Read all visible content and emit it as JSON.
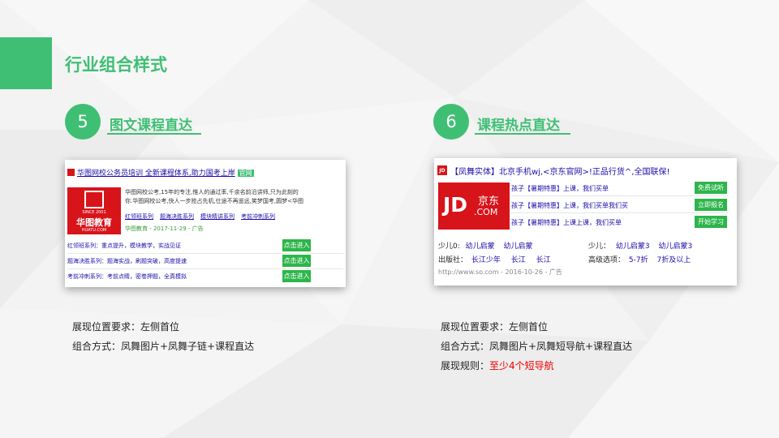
{
  "page_title": "行业组合样式",
  "colors": {
    "accent": "#3fbf74",
    "button_green": "#2db54b",
    "link": "#1a0dab",
    "red": "#e00000",
    "jd_red": "#d7141a"
  },
  "section1": {
    "number": "5",
    "title": "图文课程直达",
    "card": {
      "logo_icon": "hu-logo-icon",
      "title_link": "华图网校公务员培训 全新课程体系,助力国考上岸",
      "badge": "官网",
      "logo_text": "华图教育",
      "logo_sub": "SINCE 2001",
      "logo_url": "HUATU.COM",
      "desc1": "华图网校公考,15年的专注,惟人的通过率,千余名前沿讲师,只为此刻的",
      "desc2": "你.华图网校公考,快人一步抢占先机,仕途不再遥远,笑梦国考,圆梦<华图",
      "sublinks": [
        "红领班系列",
        "题海决胜系列",
        "模块精讲系列",
        "考前冲刺系列"
      ],
      "meta": "华图教育 - 2017-11-29 - 广告",
      "rows": [
        {
          "text": "红领班系列：重点提升，模块教学，实战见证",
          "button": "点击进入"
        },
        {
          "text": "题海决胜系列：题海实战，刷题突破，高度提速",
          "button": "点击进入"
        },
        {
          "text": "考前冲刺系列：考前点睛，密卷押题，全真模拟",
          "button": "点击进入"
        }
      ]
    },
    "desc": [
      {
        "text": "展现位置要求：左侧首位"
      },
      {
        "text": "组合方式：凤舞图片+凤舞子链+课程直达"
      }
    ]
  },
  "section2": {
    "number": "6",
    "title": "课程热点直达",
    "card": {
      "jd_icon_text": "JD",
      "title_link": "【凤舞实体】北京手机wj,<京东官网>!正品行货^,全国联保!",
      "logo_main": "JD",
      "logo_cn": "京东",
      "logo_com": ".COM",
      "rows": [
        {
          "text": "孩子【暑期特惠】上课，我们买单",
          "button": "免费试听"
        },
        {
          "text": "孩子【暑期特惠】上课，我们买单我们买",
          "button": "立即报名"
        },
        {
          "text": "孩子【暑期特惠】上课上课，我们买单",
          "button": "开始学习"
        }
      ],
      "attrs": [
        {
          "label": "少儿0:",
          "values": [
            "幼儿启蒙",
            "幼儿启蒙"
          ]
        },
        {
          "label": "少儿：",
          "values": [
            "幼儿启蒙3",
            "幼儿启蒙3"
          ]
        },
        {
          "label": "出版社：",
          "values": [
            "长江少年",
            "长江",
            "长江"
          ]
        },
        {
          "label": "高级选项：",
          "values": [
            "5-7折",
            "7折及以上"
          ]
        }
      ],
      "url": "http://www.so.com - 2016-10-26 - 广告"
    },
    "desc": [
      {
        "text": "展现位置要求：左侧首位"
      },
      {
        "text": "组合方式：凤舞图片+凤舞短导航+课程直达"
      },
      {
        "label": "展现规则：",
        "value": "至少4个短导航"
      }
    ]
  }
}
